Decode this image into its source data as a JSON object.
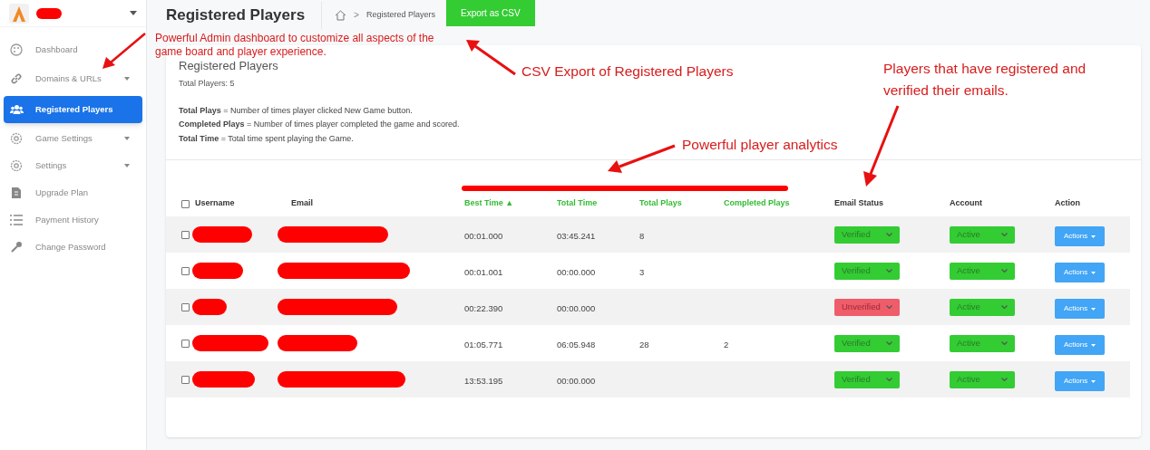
{
  "sidebar": {
    "items": [
      {
        "label": "Dashboard",
        "has_caret": false,
        "selected": false
      },
      {
        "label": "Domains & URLs",
        "has_caret": true,
        "selected": false
      },
      {
        "label": "Registered Players",
        "has_caret": false,
        "selected": true
      },
      {
        "label": "Game Settings",
        "has_caret": true,
        "selected": false
      },
      {
        "label": "Settings",
        "has_caret": true,
        "selected": false
      },
      {
        "label": "Upgrade Plan",
        "has_caret": false,
        "selected": false
      },
      {
        "label": "Payment History",
        "has_caret": false,
        "selected": false
      },
      {
        "label": "Change Password",
        "has_caret": false,
        "selected": false
      }
    ]
  },
  "header": {
    "title": "Registered Players",
    "breadcrumb_separator": ">",
    "breadcrumb": "Registered Players",
    "export_button": "Export as CSV"
  },
  "card": {
    "title": "Registered Players",
    "total_players": "Total Players: 5",
    "notes": [
      "**Total Plays** = Number of times player clicked New Game button.",
      "**Completed Plays** = Number of times player completed the game and scored.",
      "**Total Time** = Total time spent playing the Game."
    ]
  },
  "table": {
    "select_all_checked": false,
    "columns": [
      {
        "label": "Username",
        "analytics": false
      },
      {
        "label": "Email",
        "analytics": false
      },
      {
        "label": "Best Time ▲",
        "analytics": true
      },
      {
        "label": "Total Time",
        "analytics": true
      },
      {
        "label": "Total Plays",
        "analytics": true
      },
      {
        "label": "Completed Plays",
        "analytics": true
      },
      {
        "label": "Email Status",
        "analytics": false
      },
      {
        "label": "Account",
        "analytics": false
      },
      {
        "label": "Action",
        "analytics": false
      }
    ],
    "rows": [
      {
        "checked": false,
        "best_time": "00:01.000",
        "total_time": "03:45.241",
        "total_plays": "8",
        "completed_plays": "",
        "email_status": {
          "text": "Verified",
          "verified": true
        },
        "account": {
          "text": "Active",
          "active": true
        },
        "action": "Actions"
      },
      {
        "checked": false,
        "best_time": "00:01.001",
        "total_time": "00:00.000",
        "total_plays": "3",
        "completed_plays": "",
        "email_status": {
          "text": "Verified",
          "verified": true
        },
        "account": {
          "text": "Active",
          "active": true
        },
        "action": "Actions"
      },
      {
        "checked": false,
        "best_time": "00:22.390",
        "total_time": "00:00.000",
        "total_plays": "",
        "completed_plays": "",
        "email_status": {
          "text": "Unverified",
          "verified": false
        },
        "account": {
          "text": "Active",
          "active": true
        },
        "action": "Actions"
      },
      {
        "checked": false,
        "best_time": "01:05.771",
        "total_time": "06:05.948",
        "total_plays": "28",
        "completed_plays": "2",
        "email_status": {
          "text": "Verified",
          "verified": true
        },
        "account": {
          "text": "Active",
          "active": true
        },
        "action": "Actions"
      },
      {
        "checked": false,
        "best_time": "13:53.195",
        "total_time": "00:00.000",
        "total_plays": "",
        "completed_plays": "",
        "email_status": {
          "text": "Verified",
          "verified": true
        },
        "account": {
          "text": "Active",
          "active": true
        },
        "action": "Actions"
      }
    ]
  },
  "annotations": [
    {
      "text": "Powerful Admin dashboard to customize all aspects of the game board and player experience."
    },
    {
      "text": "CSV Export of Registered Players"
    },
    {
      "text": "Players that have registered and verified their emails."
    },
    {
      "text": "Powerful player analytics"
    }
  ]
}
